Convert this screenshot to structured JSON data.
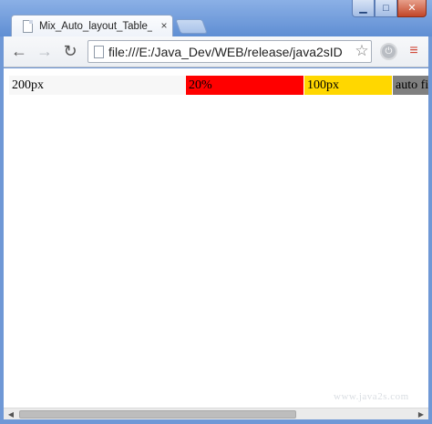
{
  "browser": {
    "tab_title": "Mix_Auto_layout_Table_w",
    "tab_close": "×",
    "url": "file:///E:/Java_Dev/WEB/release/java2sID",
    "window_buttons": {
      "minimize": "▁",
      "maximize": "□",
      "close": "✕"
    },
    "nav": {
      "back": "←",
      "forward": "→",
      "reload": "↻"
    },
    "star": "☆",
    "menu": "≡"
  },
  "table": {
    "cells": [
      {
        "text": "200px",
        "bg": "#f7f7f7"
      },
      {
        "text": "20%",
        "bg": "#ff0000"
      },
      {
        "text": "100px",
        "bg": "#ffd700"
      },
      {
        "text": "auto fi",
        "bg": "#808080"
      }
    ]
  },
  "watermark": "www.java2s.com",
  "colors": {
    "frame": "#6f98d6",
    "close_button": "#c24628"
  }
}
